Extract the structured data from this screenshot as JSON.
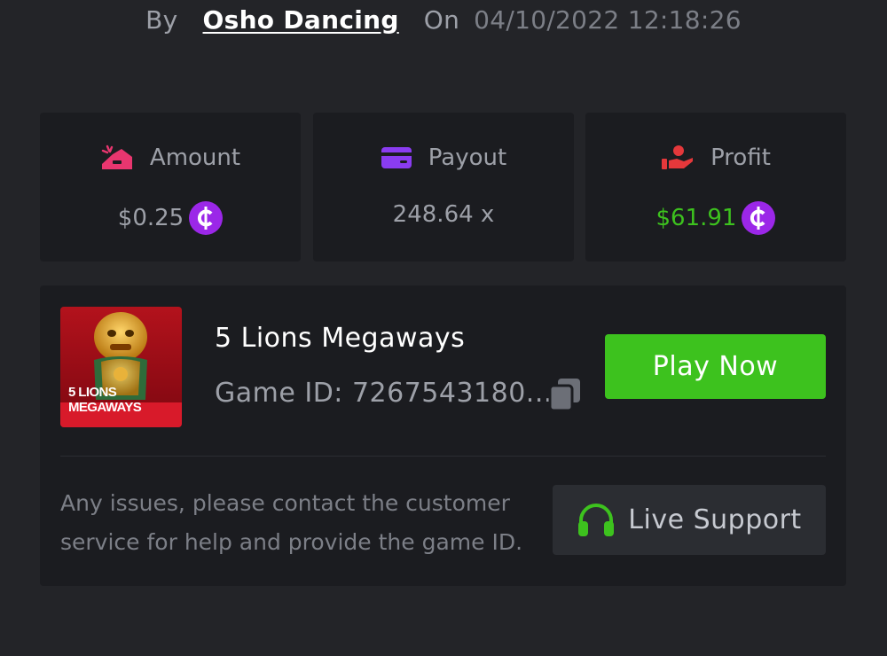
{
  "byline": {
    "by_label": "By",
    "username": "Osho Dancing",
    "on_label": "On",
    "datetime": "04/10/2022 12:18:26"
  },
  "stats": {
    "amount": {
      "label": "Amount",
      "value": "$0.25",
      "icon": "wallet-icon",
      "currency_icon": "coin-icon"
    },
    "payout": {
      "label": "Payout",
      "value": "248.64 x",
      "icon": "credit-card-icon"
    },
    "profit": {
      "label": "Profit",
      "value": "$61.91",
      "icon": "hand-profit-icon",
      "currency_icon": "coin-icon"
    }
  },
  "game": {
    "title": "5 Lions Megaways",
    "id_text": "Game ID: 7267543180...",
    "thumbnail_caption_line1": "5 LIONS",
    "thumbnail_caption_line2": "MEGAWAYS",
    "play_label": "Play Now"
  },
  "support": {
    "message": "Any issues, please contact the customer service for help and provide the game ID.",
    "button_label": "Live Support",
    "icon": "headset-icon"
  },
  "colors": {
    "background": "#232428",
    "card": "#1b1c20",
    "accent_green": "#3dc21e",
    "coin_purple": "#9b27e8",
    "muted_text": "#9da0a8",
    "amount_icon": "#e8366f",
    "payout_icon": "#8a3cf0",
    "profit_icon": "#e5383b"
  }
}
